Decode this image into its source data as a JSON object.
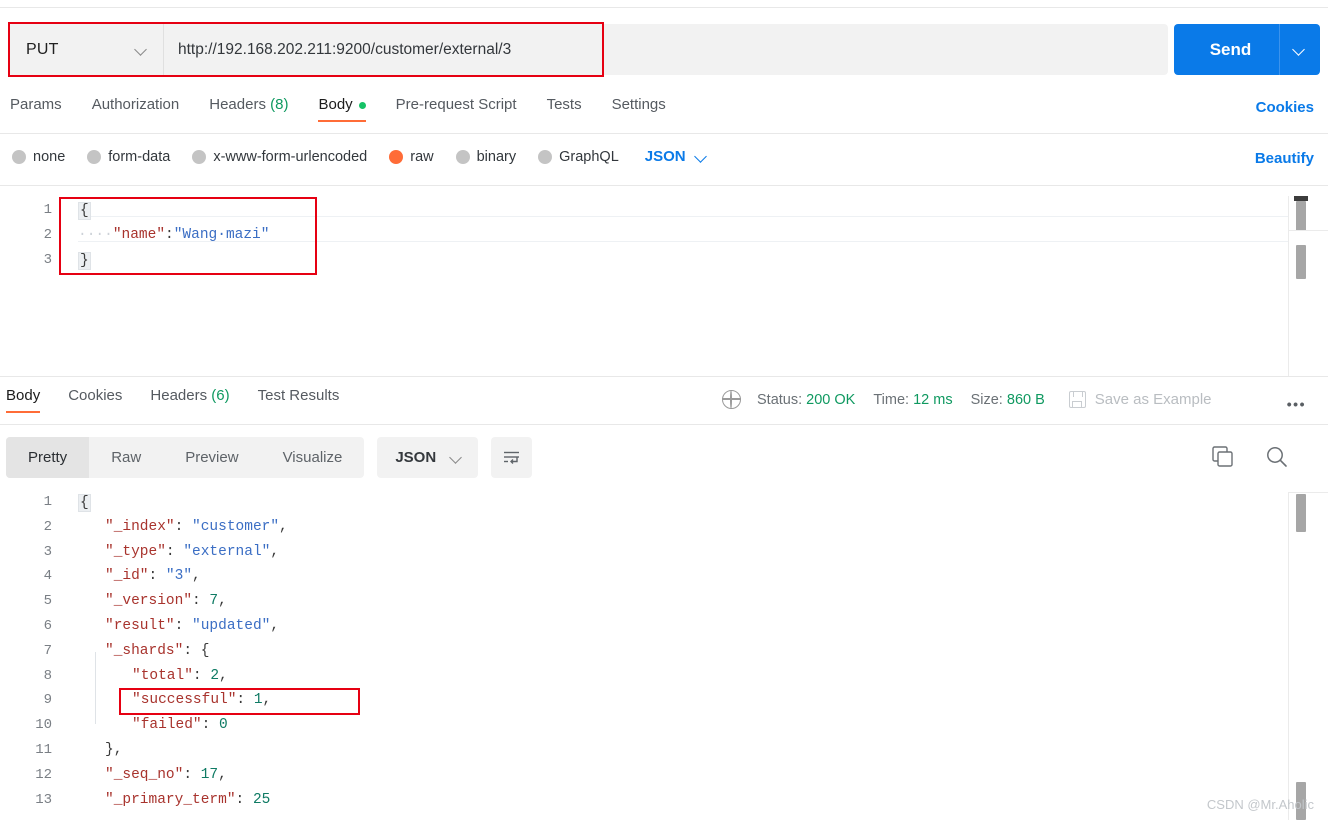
{
  "request": {
    "method": "PUT",
    "url": "http://192.168.202.211:9200/customer/external/3",
    "send_label": "Send",
    "tabs": [
      {
        "label": "Params",
        "count": "",
        "active": false,
        "dot": false
      },
      {
        "label": "Authorization",
        "count": "",
        "active": false,
        "dot": false
      },
      {
        "label": "Headers",
        "count": "(8)",
        "active": false,
        "dot": false
      },
      {
        "label": "Body",
        "count": "",
        "active": true,
        "dot": true
      },
      {
        "label": "Pre-request Script",
        "count": "",
        "active": false,
        "dot": false
      },
      {
        "label": "Tests",
        "count": "",
        "active": false,
        "dot": false
      },
      {
        "label": "Settings",
        "count": "",
        "active": false,
        "dot": false
      }
    ],
    "cookies_link": "Cookies",
    "body_types": [
      {
        "label": "none",
        "selected": false
      },
      {
        "label": "form-data",
        "selected": false
      },
      {
        "label": "x-www-form-urlencoded",
        "selected": false
      },
      {
        "label": "raw",
        "selected": true
      },
      {
        "label": "binary",
        "selected": false
      },
      {
        "label": "GraphQL",
        "selected": false
      }
    ],
    "raw_format": "JSON",
    "beautify_link": "Beautify",
    "body_lines": [
      {
        "no": "1",
        "tokens": [
          {
            "t": "{",
            "c": "fold"
          }
        ]
      },
      {
        "no": "2",
        "tokens": [
          {
            "t": "····",
            "c": "lead"
          },
          {
            "t": "\"name\"",
            "c": "k"
          },
          {
            "t": ":",
            "c": "p"
          },
          {
            "t": "\"Wang·mazi\"",
            "c": "s"
          }
        ]
      },
      {
        "no": "3",
        "tokens": [
          {
            "t": "}",
            "c": "fold"
          }
        ]
      }
    ]
  },
  "response": {
    "tabs": [
      {
        "label": "Body",
        "count": "",
        "active": true
      },
      {
        "label": "Cookies",
        "count": "",
        "active": false
      },
      {
        "label": "Headers",
        "count": "(6)",
        "active": false
      },
      {
        "label": "Test Results",
        "count": "",
        "active": false
      }
    ],
    "status_label": "Status:",
    "status_value": "200 OK",
    "time_label": "Time:",
    "time_value": "12 ms",
    "size_label": "Size:",
    "size_value": "860 B",
    "save_as_example": "Save as Example",
    "more_actions": "•••",
    "view_modes": [
      {
        "label": "Pretty",
        "active": true
      },
      {
        "label": "Raw",
        "active": false
      },
      {
        "label": "Preview",
        "active": false
      },
      {
        "label": "Visualize",
        "active": false
      }
    ],
    "format": "JSON",
    "body_lines": [
      {
        "no": "1",
        "indent": 0,
        "tokens": [
          {
            "t": "{",
            "c": "fold"
          }
        ]
      },
      {
        "no": "2",
        "indent": 1,
        "tokens": [
          {
            "t": "\"_index\"",
            "c": "k"
          },
          {
            "t": ": ",
            "c": "p"
          },
          {
            "t": "\"customer\"",
            "c": "s"
          },
          {
            "t": ",",
            "c": "p"
          }
        ]
      },
      {
        "no": "3",
        "indent": 1,
        "tokens": [
          {
            "t": "\"_type\"",
            "c": "k"
          },
          {
            "t": ": ",
            "c": "p"
          },
          {
            "t": "\"external\"",
            "c": "s"
          },
          {
            "t": ",",
            "c": "p"
          }
        ]
      },
      {
        "no": "4",
        "indent": 1,
        "tokens": [
          {
            "t": "\"_id\"",
            "c": "k"
          },
          {
            "t": ": ",
            "c": "p"
          },
          {
            "t": "\"3\"",
            "c": "s"
          },
          {
            "t": ",",
            "c": "p"
          }
        ]
      },
      {
        "no": "5",
        "indent": 1,
        "tokens": [
          {
            "t": "\"_version\"",
            "c": "k"
          },
          {
            "t": ": ",
            "c": "p"
          },
          {
            "t": "7",
            "c": "n"
          },
          {
            "t": ",",
            "c": "p"
          }
        ]
      },
      {
        "no": "6",
        "indent": 1,
        "tokens": [
          {
            "t": "\"result\"",
            "c": "k"
          },
          {
            "t": ": ",
            "c": "p"
          },
          {
            "t": "\"updated\"",
            "c": "s"
          },
          {
            "t": ",",
            "c": "p"
          }
        ]
      },
      {
        "no": "7",
        "indent": 1,
        "tokens": [
          {
            "t": "\"_shards\"",
            "c": "k"
          },
          {
            "t": ": ",
            "c": "p"
          },
          {
            "t": "{",
            "c": "p"
          }
        ]
      },
      {
        "no": "8",
        "indent": 2,
        "tokens": [
          {
            "t": "\"total\"",
            "c": "k"
          },
          {
            "t": ": ",
            "c": "p"
          },
          {
            "t": "2",
            "c": "n"
          },
          {
            "t": ",",
            "c": "p"
          }
        ]
      },
      {
        "no": "9",
        "indent": 2,
        "tokens": [
          {
            "t": "\"successful\"",
            "c": "k"
          },
          {
            "t": ": ",
            "c": "p"
          },
          {
            "t": "1",
            "c": "n"
          },
          {
            "t": ",",
            "c": "p"
          }
        ]
      },
      {
        "no": "10",
        "indent": 2,
        "tokens": [
          {
            "t": "\"failed\"",
            "c": "k"
          },
          {
            "t": ": ",
            "c": "p"
          },
          {
            "t": "0",
            "c": "n"
          }
        ]
      },
      {
        "no": "11",
        "indent": 1,
        "tokens": [
          {
            "t": "}",
            "c": "p"
          },
          {
            "t": ",",
            "c": "p"
          }
        ]
      },
      {
        "no": "12",
        "indent": 1,
        "tokens": [
          {
            "t": "\"_seq_no\"",
            "c": "k"
          },
          {
            "t": ": ",
            "c": "p"
          },
          {
            "t": "17",
            "c": "n"
          },
          {
            "t": ",",
            "c": "p"
          }
        ]
      },
      {
        "no": "13",
        "indent": 1,
        "tokens": [
          {
            "t": "\"_primary_term\"",
            "c": "k"
          },
          {
            "t": ": ",
            "c": "p"
          },
          {
            "t": "25",
            "c": "n"
          }
        ]
      }
    ]
  },
  "watermark": "CSDN @Mr.Aholic",
  "colors": {
    "accent_orange": "#ff6c37",
    "accent_blue": "#0a7ae8",
    "status_green": "#0f9960",
    "annotation_red": "#e60012",
    "json_key": "#a8332d",
    "json_string": "#3b6ec4",
    "json_number": "#0f7b64"
  }
}
